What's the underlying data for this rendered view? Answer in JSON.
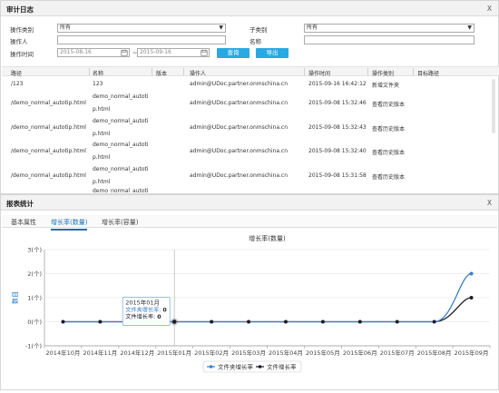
{
  "audit": {
    "title": "审计日志",
    "close": "X",
    "filters": {
      "op_type_label": "操作类别",
      "op_type_value": "所有",
      "sub_type_label": "子类别",
      "sub_type_value": "所有",
      "operator_label": "操作人",
      "operator_value": "",
      "name_label": "名称",
      "name_value": "",
      "time_label": "操作时间",
      "date_from": "2015-08-16",
      "date_sep": "~",
      "date_to": "2015-09-16",
      "query_button": "查询",
      "export_button": "导出"
    },
    "columns": [
      "路径",
      "名称",
      "版本",
      "操作人",
      "操作时间",
      "操作类别",
      "目标路径"
    ],
    "rows": [
      {
        "path": "/123",
        "name1": "123",
        "name2": "",
        "version": "",
        "operator": "admin@UDoc.partner.onmschina.cn",
        "time": "2015-09-16 16:42:12",
        "type": "新增文件夹"
      },
      {
        "path": "/demo_normal_autotip.html",
        "name1": "demo_normal_autoti",
        "name2": "p.html",
        "version": "",
        "operator": "admin@UDoc.partner.onmschina.cn",
        "time": "2015-09-08 15:32:46",
        "type": "查看历史版本"
      },
      {
        "path": "/demo_normal_autotip.html",
        "name1": "demo_normal_autoti",
        "name2": "p.html",
        "version": "",
        "operator": "admin@UDoc.partner.onmschina.cn",
        "time": "2015-09-08 15:32:43",
        "type": "查看历史版本"
      },
      {
        "path": "/demo_normal_autotip.html",
        "name1": "demo_normal_autoti",
        "name2": "p.html",
        "version": "",
        "operator": "admin@UDoc.partner.onmschina.cn",
        "time": "2015-09-08 15:32:40",
        "type": "查看历史版本"
      },
      {
        "path": "/demo_normal_autotip.html",
        "name1": "demo_normal_autoti",
        "name2": "p.html",
        "version": "",
        "operator": "admin@UDoc.partner.onmschina.cn",
        "time": "2015-09-08 15:31:58",
        "type": "查看历史版本"
      },
      {
        "path": "",
        "name1": "demo_normal_autoti",
        "name2": "",
        "version": "",
        "operator": "",
        "time": "",
        "type": ""
      }
    ]
  },
  "report": {
    "title": "报表统计",
    "close": "X",
    "tabs": [
      "基本属性",
      "增长率(数量)",
      "增长率(容量)"
    ],
    "active_tab": 1
  },
  "chart_data": {
    "type": "line",
    "title": "增长率(数量)",
    "ylabel": "数目",
    "xlabel": "",
    "categories": [
      "2014年10月",
      "2014年11月",
      "2014年12月",
      "2015年01月",
      "2015年02月",
      "2015年03月",
      "2015年04月",
      "2015年05月",
      "2015年06月",
      "2015年07月",
      "2015年08月",
      "2015年09月"
    ],
    "ylim": [
      -1,
      3
    ],
    "yticks": [
      "-1(个)",
      "0(个)",
      "1(个)",
      "2(个)",
      "3(个)"
    ],
    "series": [
      {
        "name": "文件夹增长率",
        "color": "#3b7fc4",
        "values": [
          0,
          0,
          0,
          0,
          0,
          0,
          0,
          0,
          0,
          0,
          0,
          2
        ]
      },
      {
        "name": "文件增长率",
        "color": "#1b1b2b",
        "values": [
          0,
          0,
          0,
          0,
          0,
          0,
          0,
          0,
          0,
          0,
          0,
          1
        ]
      }
    ],
    "tooltip": {
      "category": "2015年01月",
      "lines": [
        {
          "label": "文件夹增长率: ",
          "value": "0"
        },
        {
          "label": "文件增长率: ",
          "value": "0"
        }
      ]
    },
    "crosshair_category": "2015年01月",
    "grid": true,
    "legend": "bottom"
  }
}
